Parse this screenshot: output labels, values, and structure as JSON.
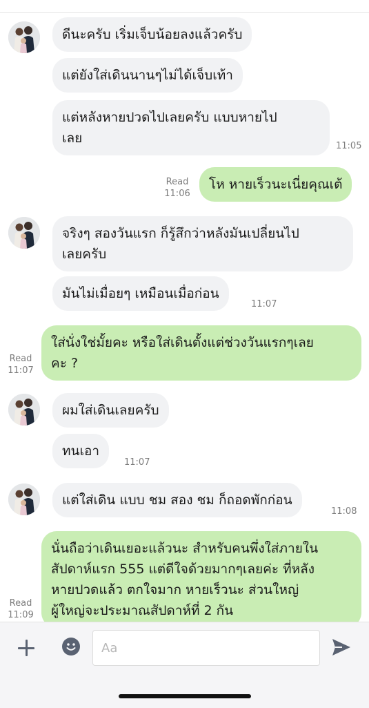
{
  "messages": [
    {
      "text": "ดีนะครับ เริ่มเจ็บน้อยลงแล้วครับ"
    },
    {
      "text": "แต่ยังใส่เดินนานๆไม่ได้เจ็บเท้า"
    },
    {
      "line1": "แต่หลังหายปวดไปเลยครับ แบบหายไป",
      "line2": "เลย",
      "time": "11:05"
    },
    {
      "text": "โห หายเร็วนะเนี่ยคุณเต้",
      "read": "Read",
      "time": "11:06"
    },
    {
      "line1": "จริงๆ สองวันแรก ก็รู้สึกว่าหลังมันเปลี่ยนไป",
      "line2": "เลยครับ"
    },
    {
      "text": "มันไม่เมื่อยๆ เหมือนเมื่อก่อน",
      "time": "11:07"
    },
    {
      "line1": "ใส่นั่งใช่มั้ยคะ หรือใส่เดินตั้งแต่ช่วงวันแรกๆเลย",
      "line2": "คะ ?",
      "read": "Read",
      "time": "11:07"
    },
    {
      "text": "ผมใส่เดินเลยครับ"
    },
    {
      "text": "ทนเอา",
      "time": "11:07"
    },
    {
      "text": "แต่ใส่เดิน แบบ ชม สอง ชม ก็ถอดพักก่อน",
      "time": "11:08"
    },
    {
      "line1": "นั่นถือว่าเดินเยอะแล้วนะ สำหรับคนพึ่งใส่ภายใน",
      "line2": "สัปดาห์แรก 555 แต่ดีใจด้วยมากๆเลยค่ะ ที่หลัง",
      "line3": "หายปวดแล้ว ตกใจมาก หายเร็วนะ ส่วนใหญ่",
      "line4": "ผู้ใหญ่จะประมาณสัปดาห์ที่ 2 กัน",
      "read": "Read",
      "time": "11:09"
    }
  ],
  "composer": {
    "placeholder": "Aa",
    "icons": {
      "add": "plus-icon",
      "emoji": "emoji-icon",
      "send": "send-icon"
    }
  },
  "colors": {
    "incoming_bubble": "#f1f2f4",
    "outgoing_bubble": "#c9edb4",
    "timestamp": "#7d7d7d"
  }
}
